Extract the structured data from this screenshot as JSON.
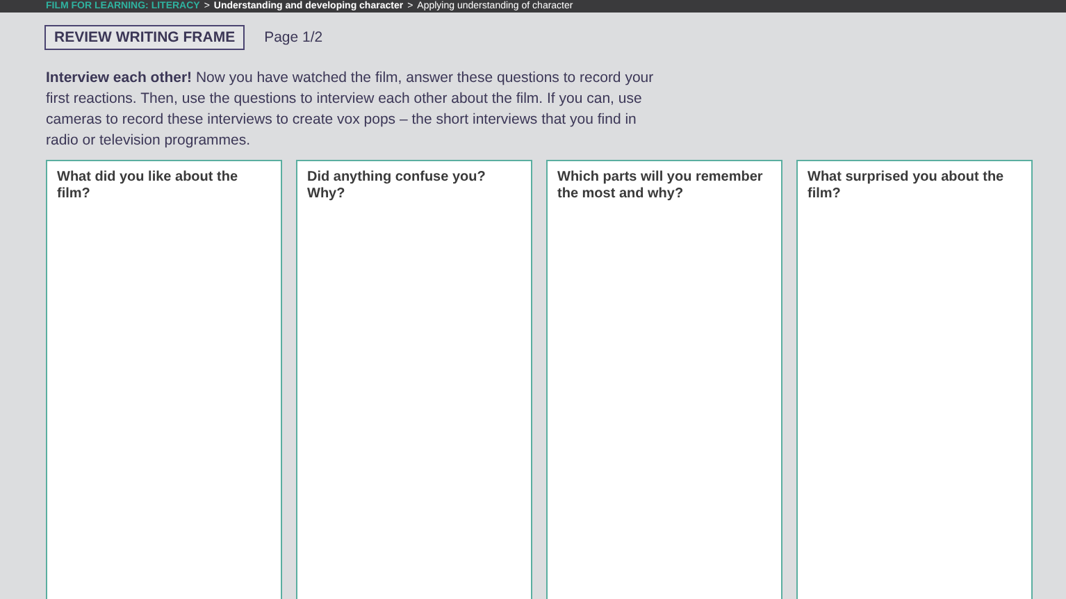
{
  "breadcrumb": {
    "section": "FILM FOR LEARNING: LITERACY",
    "path": [
      {
        "text": "Understanding and developing character",
        "bold": true
      },
      {
        "text": "Applying understanding of character",
        "bold": false
      }
    ],
    "separator": ">"
  },
  "header": {
    "title": "REVIEW WRITING FRAME",
    "page": "Page 1/2"
  },
  "intro": "**Interview each other!** Now you have watched the film, answer these questions to record your first reactions. Then, use the questions to interview each other about the film. If you can, use cameras to record these interviews to create vox pops – the short interviews that you find in radio or television programmes.",
  "questions": [
    "What did you like about the film?",
    "Did anything confuse you? Why?",
    "Which parts will you remember the most and why?",
    "What surprised you about the film?"
  ]
}
